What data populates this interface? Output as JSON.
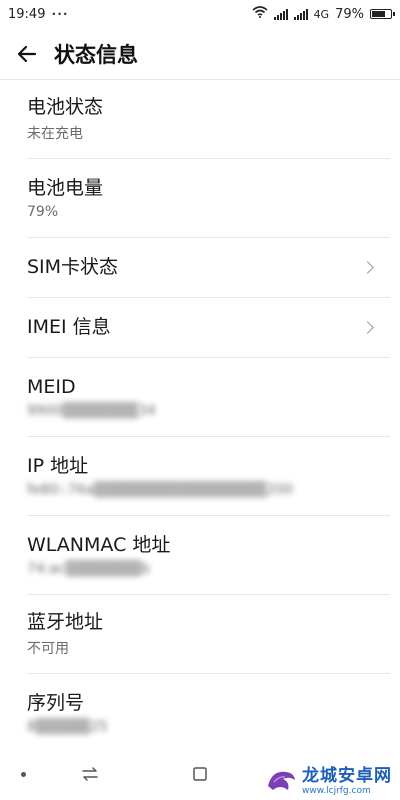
{
  "status_bar": {
    "time": "19:49",
    "dots": "•••",
    "network": "4G",
    "battery_text": "79%",
    "battery_level": 0.79
  },
  "header": {
    "title": "状态信息"
  },
  "rows": [
    {
      "title": "电池状态",
      "subtitle": "未在充电"
    },
    {
      "title": "电池电量",
      "subtitle": "79%"
    },
    {
      "title": "SIM卡状态"
    },
    {
      "title": "IMEI 信息"
    },
    {
      "title": "MEID",
      "subtitle": "9900▒▒▒▒▒▒▒34"
    },
    {
      "title": "IP 地址",
      "subtitle": "fe80::76a▒▒▒▒▒▒▒▒▒▒▒▒▒▒▒▒200"
    },
    {
      "title": "WLANMAC 地址",
      "subtitle": "74:ac▒▒▒▒▒▒▒b"
    },
    {
      "title": "蓝牙地址",
      "subtitle": "不可用"
    },
    {
      "title": "序列号",
      "subtitle": "8▒▒▒▒▒25"
    }
  ],
  "watermark": {
    "name": "龙城安卓网",
    "url": "www.lcjrfg.com"
  },
  "colors": {
    "background": "#ffffff",
    "text_primary": "#1a1a1a",
    "text_secondary": "#6b6b6b",
    "divider": "#e8e8e8",
    "watermark_blue": "#1d5fb8"
  },
  "icons": [
    "wifi-icon",
    "signal-icon",
    "battery-icon",
    "back-arrow-icon",
    "chevron-right-icon",
    "nav-menu-icon",
    "nav-switch-icon",
    "nav-recents-icon",
    "dragon-logo-icon"
  ]
}
